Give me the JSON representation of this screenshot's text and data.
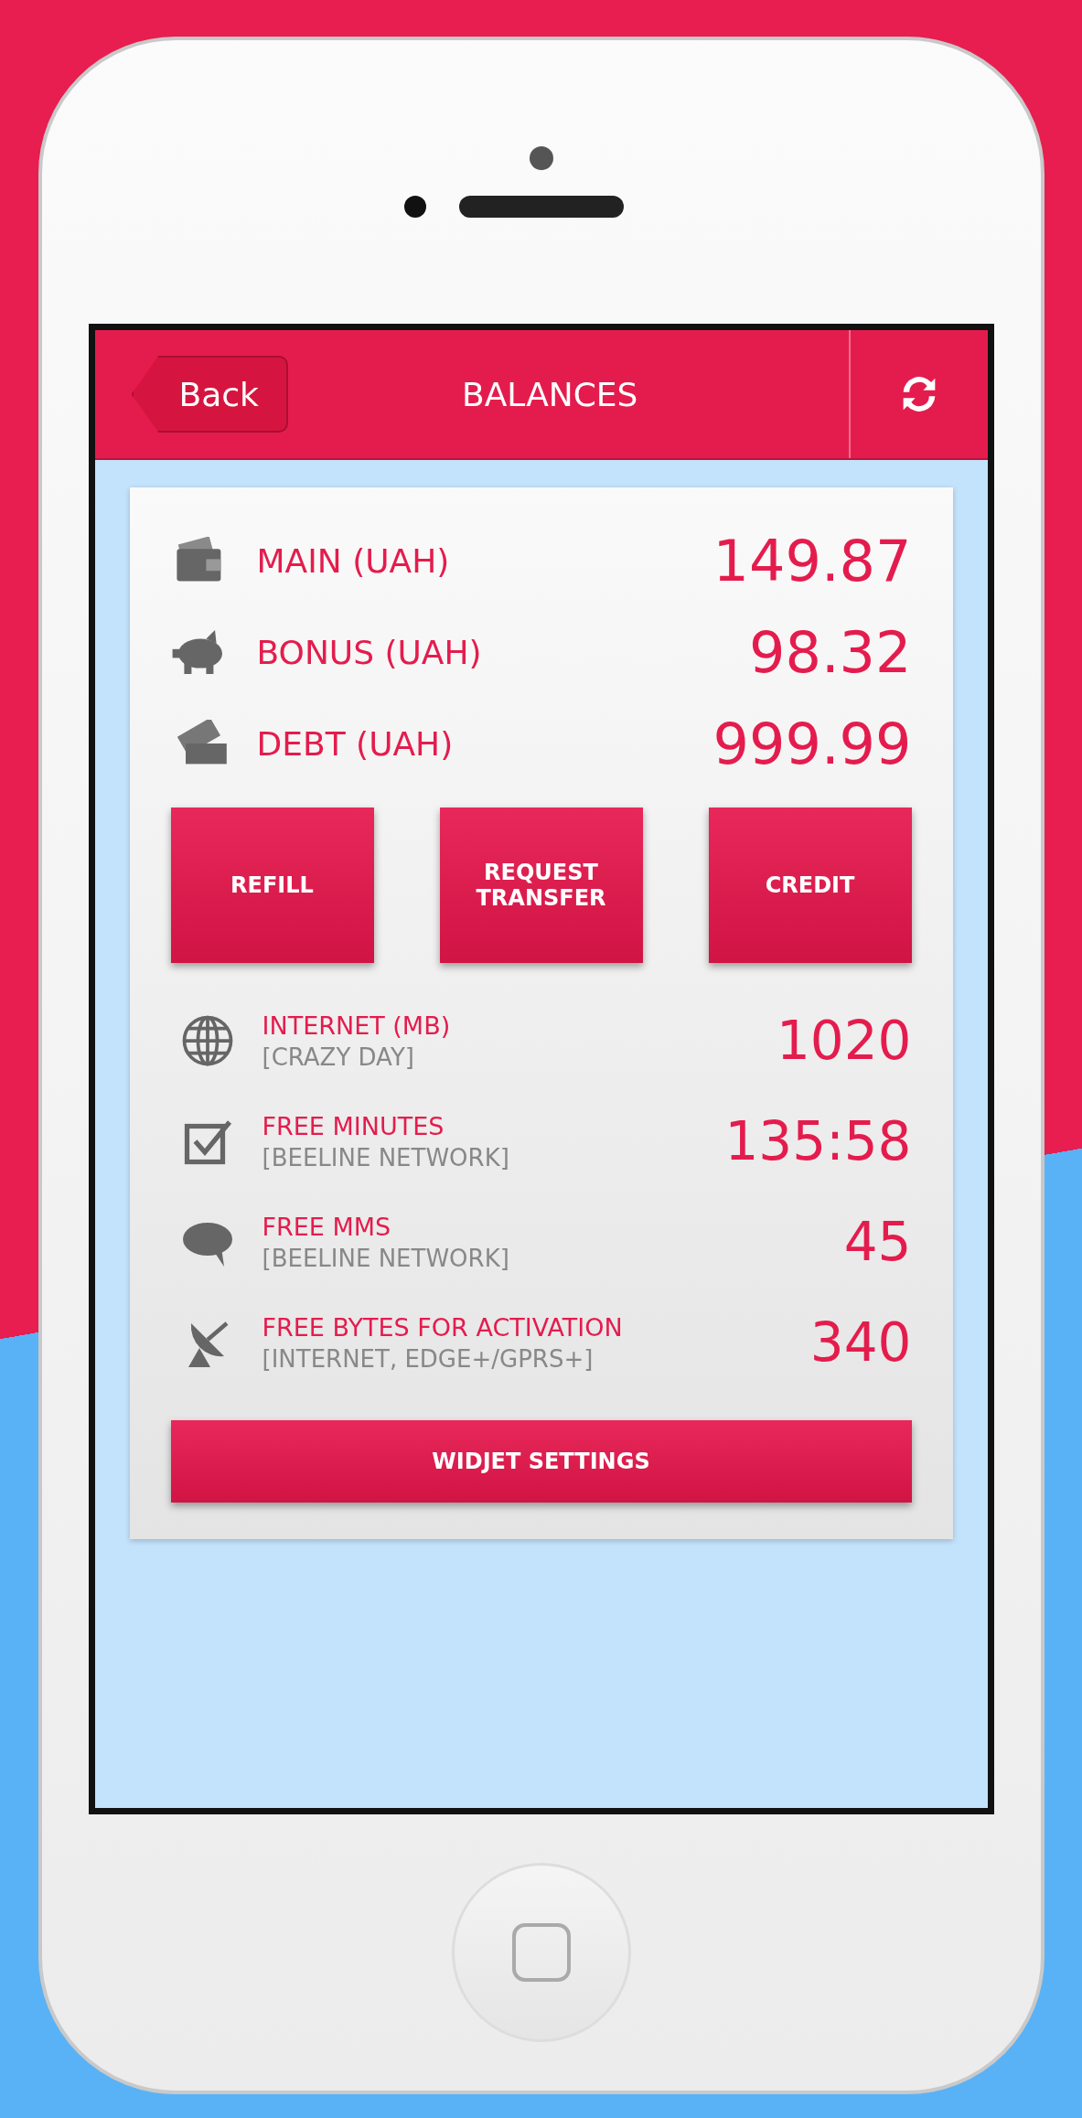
{
  "header": {
    "back": "Back",
    "title": "BALANCES"
  },
  "balances": [
    {
      "kind": "wallet",
      "label": "MAIN (UAH)",
      "value": "149.87"
    },
    {
      "kind": "piggy",
      "label": "BONUS (UAH)",
      "value": "98.32"
    },
    {
      "kind": "cards",
      "label": "DEBT (UAH)",
      "value": "999.99"
    }
  ],
  "actions": [
    "REFILL",
    "REQUEST TRANSFER",
    "CREDIT"
  ],
  "services": [
    {
      "kind": "globe",
      "label": "INTERNET (MB)",
      "note": "[CRAZY DAY]",
      "value": "1020"
    },
    {
      "kind": "check",
      "label": "FREE MINUTES",
      "note": "[BEELINE NETWORK]",
      "value": "135:58"
    },
    {
      "kind": "mms",
      "label": "FREE MMS",
      "note": "[BEELINE NETWORK]",
      "value": "45"
    },
    {
      "kind": "dish",
      "label": "FREE BYTES FOR ACTIVATION",
      "note": "[INTERNET, EDGE+/GPRS+]",
      "value": "340"
    }
  ],
  "settings_button": "WIDJET SETTINGS"
}
